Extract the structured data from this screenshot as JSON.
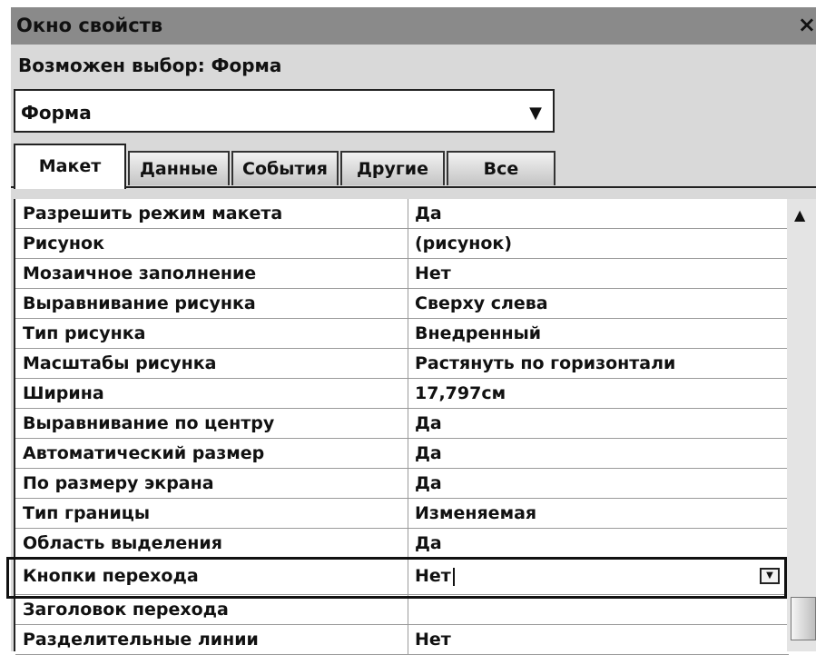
{
  "window": {
    "title": "Окно свойств",
    "close_glyph": "×"
  },
  "selection": {
    "label": "Возможен выбор:  Форма"
  },
  "combo": {
    "value": "Форма",
    "arrow_glyph": "▼"
  },
  "tabs": [
    {
      "label": "Макет",
      "active": true
    },
    {
      "label": "Данные",
      "active": false
    },
    {
      "label": "События",
      "active": false
    },
    {
      "label": "Другие",
      "active": false
    },
    {
      "label": "Все",
      "active": false
    }
  ],
  "properties": [
    {
      "name": "Разрешить режим макета",
      "value": "Да"
    },
    {
      "name": "Рисунок",
      "value": "(рисунок)"
    },
    {
      "name": "Мозаичное заполнение",
      "value": "Нет"
    },
    {
      "name": "Выравнивание рисунка",
      "value": "Сверху слева"
    },
    {
      "name": "Тип рисунка",
      "value": "Внедренный"
    },
    {
      "name": "Масштабы рисунка",
      "value": "Растянуть по горизонтали"
    },
    {
      "name": "Ширина",
      "value": "17,797см"
    },
    {
      "name": "Выравнивание по центру",
      "value": "Да"
    },
    {
      "name": "Автоматический размер",
      "value": "Да"
    },
    {
      "name": "По размеру экрана",
      "value": "Да"
    },
    {
      "name": "Тип границы",
      "value": "Изменяемая"
    },
    {
      "name": "Область выделения",
      "value": "Да"
    },
    {
      "name": "Кнопки перехода",
      "value": "Нет"
    },
    {
      "name": "Заголовок перехода",
      "value": ""
    },
    {
      "name": "Разделительные линии",
      "value": "Нет"
    }
  ],
  "scrollbar": {
    "up_glyph": "▲"
  },
  "icons": {
    "close": "close-icon",
    "dropdown": "chevron-down-icon",
    "scroll_up": "arrow-up-icon"
  }
}
